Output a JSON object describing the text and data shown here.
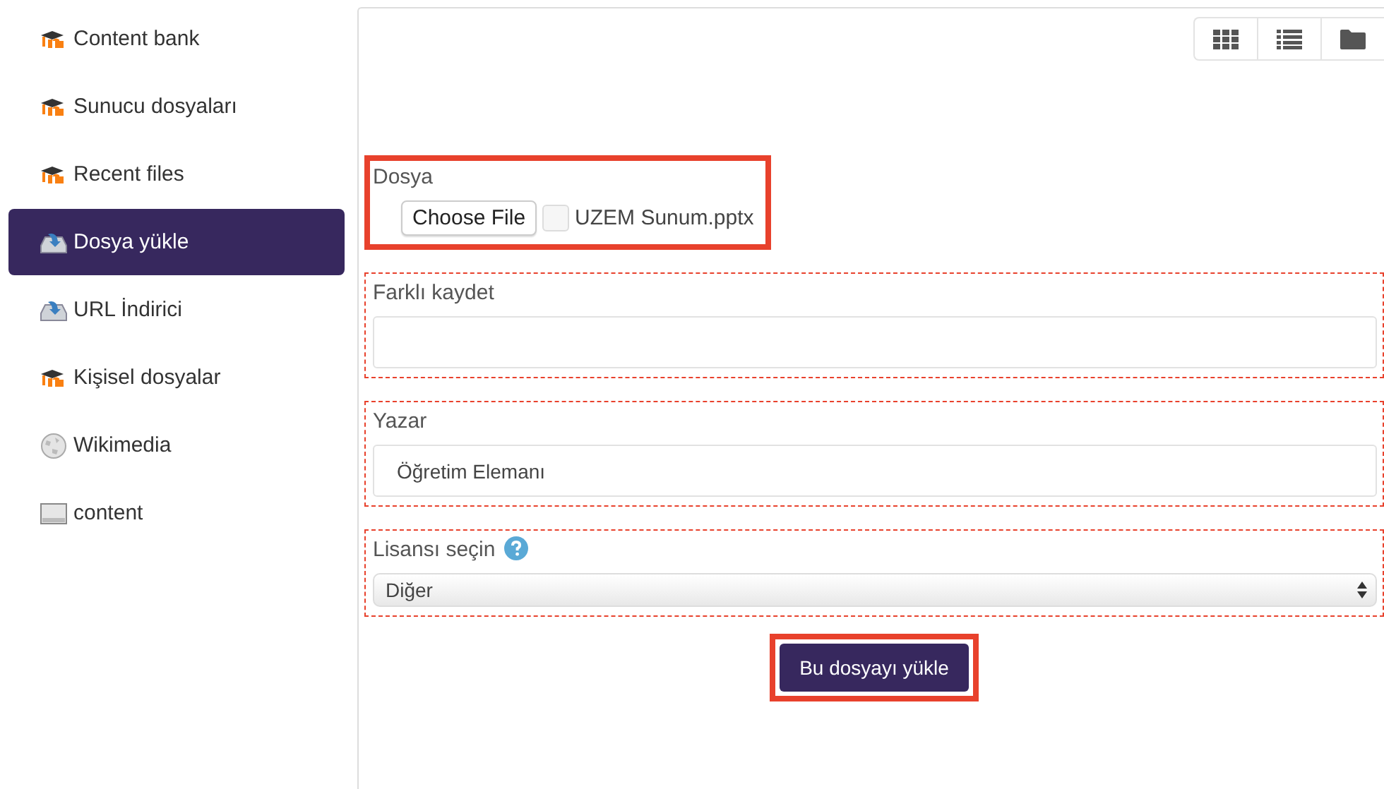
{
  "sidebar": {
    "items": [
      {
        "label": "Content bank",
        "kind": "moodle",
        "selected": false
      },
      {
        "label": "Sunucu dosyaları",
        "kind": "moodle",
        "selected": false
      },
      {
        "label": "Recent files",
        "kind": "moodle",
        "selected": false
      },
      {
        "label": "Dosya yükle",
        "kind": "upload",
        "selected": true
      },
      {
        "label": "URL İndirici",
        "kind": "upload",
        "selected": false
      },
      {
        "label": "Kişisel dosyalar",
        "kind": "moodle",
        "selected": false
      },
      {
        "label": "Wikimedia",
        "kind": "globe",
        "selected": false
      },
      {
        "label": "content",
        "kind": "drive",
        "selected": false
      }
    ]
  },
  "toolbar": {
    "buttons": [
      {
        "kind": "grid"
      },
      {
        "kind": "list"
      },
      {
        "kind": "folder"
      }
    ]
  },
  "form": {
    "fields": [
      {
        "kind": "file",
        "label": "Dosya",
        "button": "Choose File",
        "value": "UZEM Sunum.pptx",
        "checked": false,
        "highlighted": true,
        "outlined": false
      },
      {
        "kind": "text",
        "label": "Farklı kaydet",
        "highlighted": false,
        "outlined": true
      },
      {
        "kind": "text",
        "label": "Yazar",
        "value": "Öğretim Elemanı",
        "highlighted": false,
        "outlined": true
      },
      {
        "kind": "select",
        "label": "Lisansı seçin",
        "help": true,
        "value": "Diğer",
        "highlighted": false,
        "outlined": true
      }
    ],
    "submit": {
      "label": "Bu dosyayı yükle",
      "highlighted": true
    }
  }
}
